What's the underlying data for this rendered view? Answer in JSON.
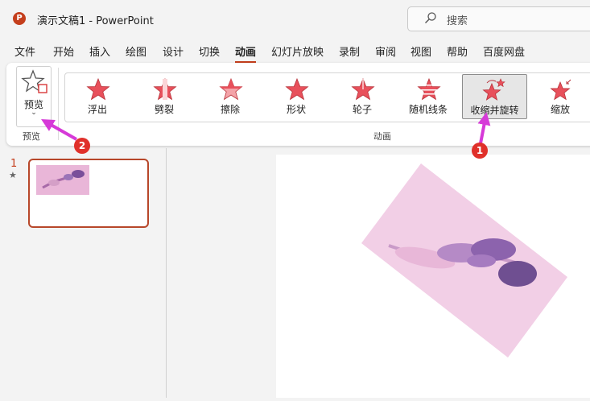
{
  "app": {
    "icon_letter": "P",
    "title": "演示文稿1  -  PowerPoint"
  },
  "search": {
    "placeholder": "搜索"
  },
  "menu": [
    "文件",
    "开始",
    "插入",
    "绘图",
    "设计",
    "切换",
    "动画",
    "幻灯片放映",
    "录制",
    "审阅",
    "视图",
    "帮助",
    "百度网盘"
  ],
  "menu_active": "动画",
  "ribbon": {
    "preview_label": "预览",
    "preview_group_label": "预览",
    "animation_group_label": "动画",
    "animations": [
      {
        "label": "浮出",
        "icon": "star-float-in-icon"
      },
      {
        "label": "劈裂",
        "icon": "star-split-icon"
      },
      {
        "label": "擦除",
        "icon": "star-wipe-icon"
      },
      {
        "label": "形状",
        "icon": "star-shape-icon"
      },
      {
        "label": "轮子",
        "icon": "star-wheel-icon"
      },
      {
        "label": "随机线条",
        "icon": "star-random-bars-icon"
      },
      {
        "label": "收缩并旋转",
        "icon": "star-shrink-turn-icon",
        "selected": true
      },
      {
        "label": "缩放",
        "icon": "star-zoom-icon"
      }
    ]
  },
  "slides_pane": {
    "slide_number": "1",
    "animation_marker": "★"
  },
  "annotations": [
    {
      "number": "1"
    },
    {
      "number": "2"
    }
  ],
  "colors": {
    "accent": "#c43e1c",
    "star_fill": "#e8505b",
    "badge": "#e0302a",
    "arrow": "#d63ad8",
    "image_bg": "#f2cfe6"
  }
}
